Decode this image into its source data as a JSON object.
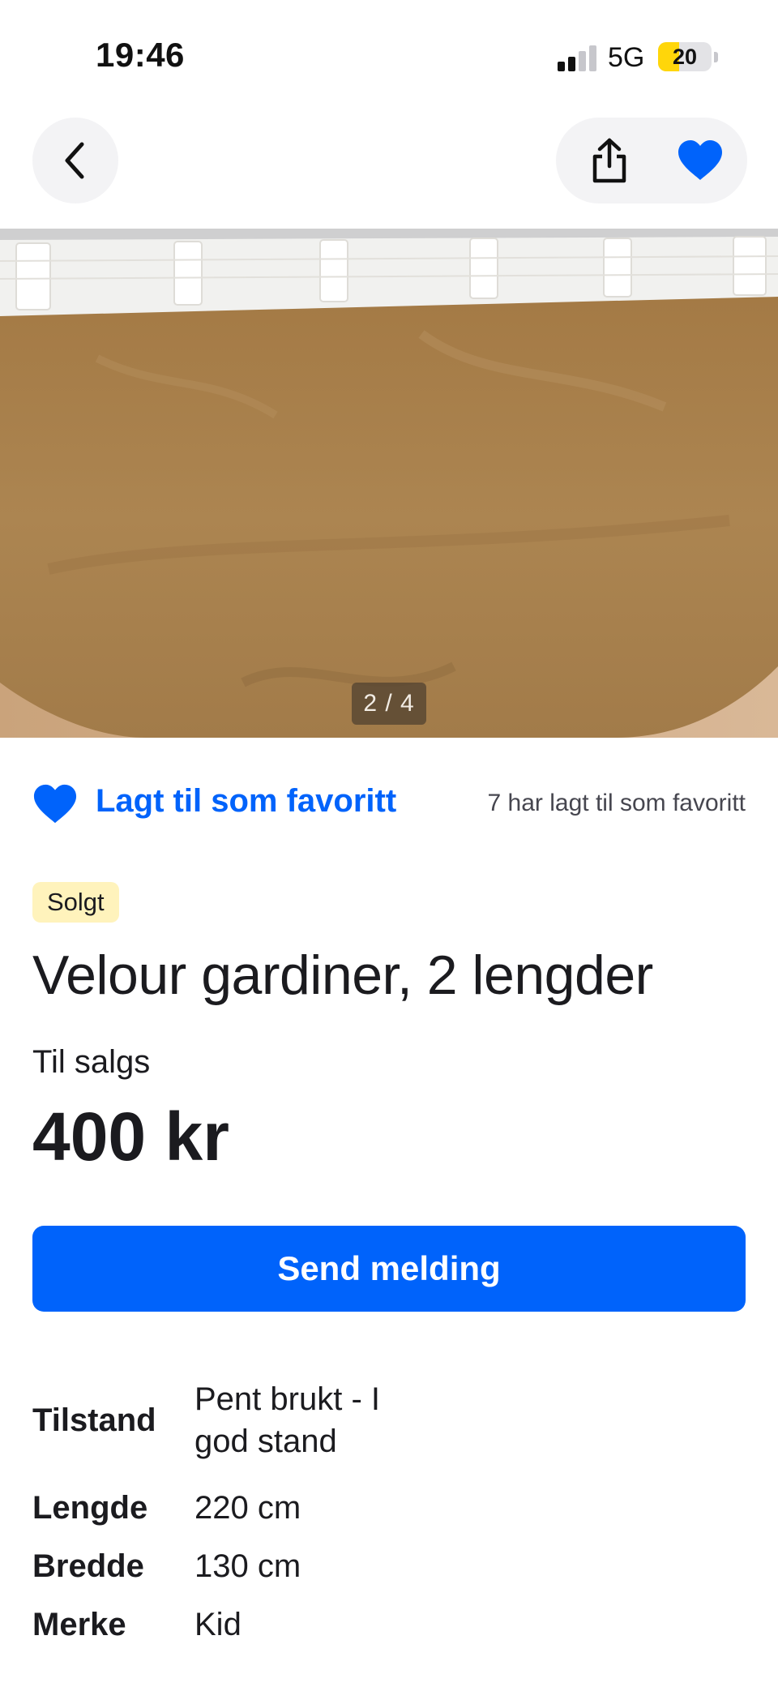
{
  "status_bar": {
    "time": "19:46",
    "network": "5G",
    "battery": "20"
  },
  "nav": {
    "back_icon": "chevron-left-icon",
    "share_icon": "share-icon",
    "favorite_icon": "heart-icon"
  },
  "gallery": {
    "counter": "2 / 4",
    "current": 2,
    "total": 4
  },
  "favorite": {
    "label": "Lagt til som favoritt",
    "count_text": "7 har lagt til som favoritt"
  },
  "listing": {
    "status_badge": "Solgt",
    "title": "Velour gardiner, 2 lengder",
    "sale_type": "Til salgs",
    "price": "400 kr"
  },
  "actions": {
    "send_label": "Send melding"
  },
  "specs": [
    {
      "key": "Tilstand",
      "value": "Pent brukt - I god stand"
    },
    {
      "key": "Lengde",
      "value": "220 cm"
    },
    {
      "key": "Bredde",
      "value": "130 cm"
    },
    {
      "key": "Merke",
      "value": "Kid"
    }
  ],
  "colors": {
    "accent": "#0063fb",
    "badge_bg": "#fff3bc",
    "text": "#1b1b1f"
  }
}
